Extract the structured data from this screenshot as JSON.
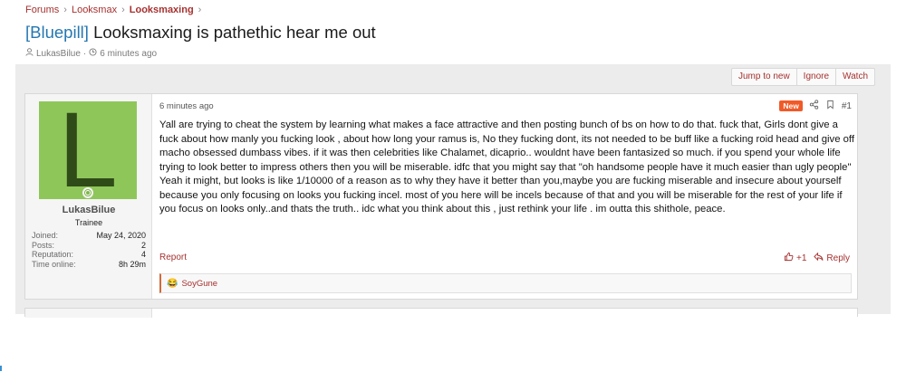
{
  "breadcrumb": {
    "items": [
      "Forums",
      "Looksmax",
      "Looksmaxing"
    ],
    "separator": "›"
  },
  "thread": {
    "prefix": "[Bluepill]",
    "title": "Looksmaxing is pathethic hear me out",
    "author": "LukasBilue",
    "meta_sep": "·",
    "time": "6 minutes ago"
  },
  "thread_buttons": {
    "jump_to_new": "Jump to new",
    "ignore": "Ignore",
    "watch": "Watch"
  },
  "post": {
    "user": {
      "avatar_letter": "L",
      "avatar_color": "#8fc65a",
      "name": "LukasBilue",
      "title": "Trainee",
      "stats": [
        {
          "label": "Joined:",
          "value": "May 24, 2020"
        },
        {
          "label": "Posts:",
          "value": "2"
        },
        {
          "label": "Reputation:",
          "value": "4"
        },
        {
          "label": "Time online:",
          "value": "8h 29m"
        }
      ]
    },
    "time": "6 minutes ago",
    "new_badge": "New",
    "number": "#1",
    "body": "Yall are trying to cheat the system by learning what makes a face attractive and then posting bunch of bs on how to do that. fuck that, Girls dont give a fuck about how manly you fucking look , about how long your ramus is, No they fucking dont, its not needed to be buff like a fucking roid head and give off macho obsessed dumbass vibes. if it was then celebrities like Chalamet, dicaprio.. wouldnt have been fantasized so much. if you spend your whole life trying to look better to impress others then you will be miserable. idfc that you might say that \"oh handsome people have it much easier than ugly people\" Yeah it might, but looks is like 1/10000 of a reason as to why they have it better than you,maybe you are fucking miserable and insecure about yourself because you only focusing on looks you fucking incel. most of you here will be incels because of that and you will be miserable for the rest of your life if you focus on looks only..and thats the truth.. idc what you think about this , just rethink your life . im outta this shithole, peace.",
    "report_label": "Report",
    "rep_label": "+1",
    "reply_label": "Reply",
    "reaction_user": "SoyGune"
  },
  "colors": {
    "link": "#a5312f",
    "prefix": "#2577b1",
    "new_badge": "#f05a28"
  }
}
